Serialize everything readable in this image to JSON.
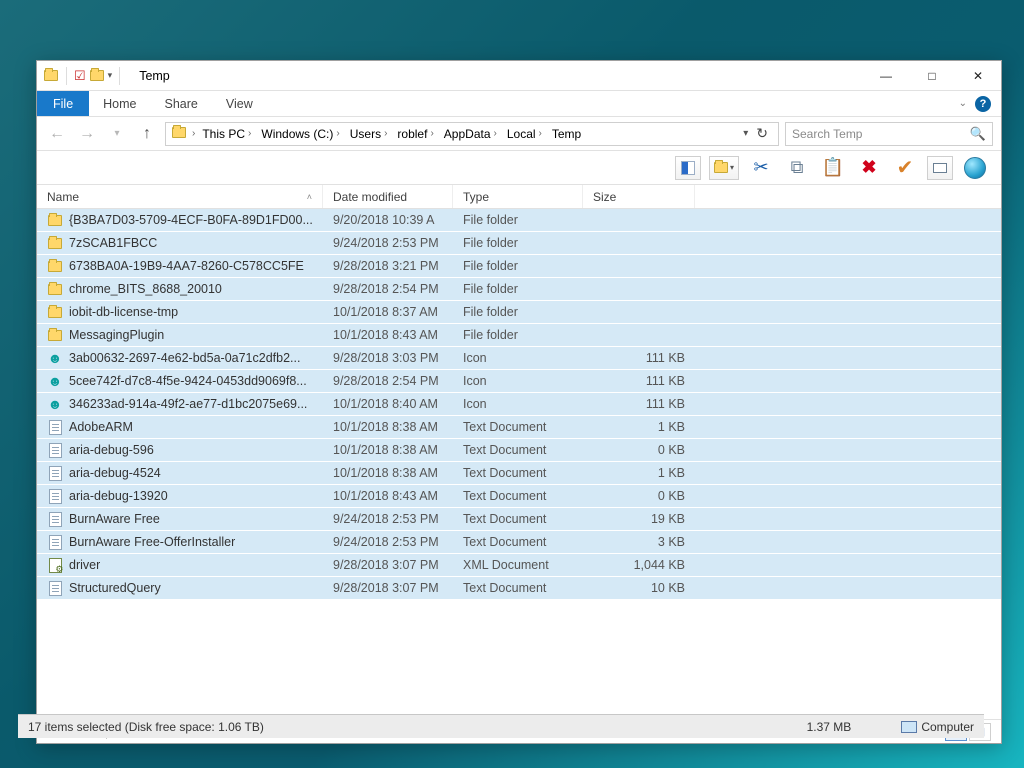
{
  "window": {
    "title": "Temp"
  },
  "ribbon": {
    "file": "File",
    "tabs": [
      "Home",
      "Share",
      "View"
    ]
  },
  "breadcrumb": {
    "segments": [
      "This PC",
      "Windows (C:)",
      "Users",
      "roblef",
      "AppData",
      "Local",
      "Temp"
    ]
  },
  "search": {
    "placeholder": "Search Temp"
  },
  "columns": {
    "name": "Name",
    "date": "Date modified",
    "type": "Type",
    "size": "Size"
  },
  "files": [
    {
      "name": "{B3BA7D03-5709-4ECF-B0FA-89D1FD00...",
      "date": "9/20/2018 10:39 A",
      "type": "File folder",
      "size": "",
      "icon": "folder"
    },
    {
      "name": "7zSCAB1FBCC",
      "date": "9/24/2018 2:53 PM",
      "type": "File folder",
      "size": "",
      "icon": "folder"
    },
    {
      "name": "6738BA0A-19B9-4AA7-8260-C578CC5FE",
      "date": "9/28/2018 3:21 PM",
      "type": "File folder",
      "size": "",
      "icon": "folder"
    },
    {
      "name": "chrome_BITS_8688_20010",
      "date": "9/28/2018 2:54 PM",
      "type": "File folder",
      "size": "",
      "icon": "folder"
    },
    {
      "name": "iobit-db-license-tmp",
      "date": "10/1/2018 8:37 AM",
      "type": "File folder",
      "size": "",
      "icon": "folder"
    },
    {
      "name": "MessagingPlugin",
      "date": "10/1/2018 8:43 AM",
      "type": "File folder",
      "size": "",
      "icon": "folder"
    },
    {
      "name": "3ab00632-2697-4e62-bd5a-0a71c2dfb2...",
      "date": "9/28/2018 3:03 PM",
      "type": "Icon",
      "size": "111 KB",
      "icon": "icon"
    },
    {
      "name": "5cee742f-d7c8-4f5e-9424-0453dd9069f8...",
      "date": "9/28/2018 2:54 PM",
      "type": "Icon",
      "size": "111 KB",
      "icon": "icon"
    },
    {
      "name": "346233ad-914a-49f2-ae77-d1bc2075e69...",
      "date": "10/1/2018 8:40 AM",
      "type": "Icon",
      "size": "111 KB",
      "icon": "icon"
    },
    {
      "name": "AdobeARM",
      "date": "10/1/2018 8:38 AM",
      "type": "Text Document",
      "size": "1 KB",
      "icon": "text"
    },
    {
      "name": "aria-debug-596",
      "date": "10/1/2018 8:38 AM",
      "type": "Text Document",
      "size": "0 KB",
      "icon": "text"
    },
    {
      "name": "aria-debug-4524",
      "date": "10/1/2018 8:38 AM",
      "type": "Text Document",
      "size": "1 KB",
      "icon": "text"
    },
    {
      "name": "aria-debug-13920",
      "date": "10/1/2018 8:43 AM",
      "type": "Text Document",
      "size": "0 KB",
      "icon": "text"
    },
    {
      "name": "BurnAware Free",
      "date": "9/24/2018 2:53 PM",
      "type": "Text Document",
      "size": "19 KB",
      "icon": "text"
    },
    {
      "name": "BurnAware Free-OfferInstaller",
      "date": "9/24/2018 2:53 PM",
      "type": "Text Document",
      "size": "3 KB",
      "icon": "text"
    },
    {
      "name": "driver",
      "date": "9/28/2018 3:07 PM",
      "type": "XML Document",
      "size": "1,044 KB",
      "icon": "xml"
    },
    {
      "name": "StructuredQuery",
      "date": "9/28/2018 3:07 PM",
      "type": "Text Document",
      "size": "10 KB",
      "icon": "text"
    }
  ],
  "status": {
    "count": "17 items",
    "selected": "17 items selected",
    "bottom": "17 items selected (Disk free space: 1.06 TB)",
    "size_total": "1.37 MB",
    "location": "Computer"
  }
}
